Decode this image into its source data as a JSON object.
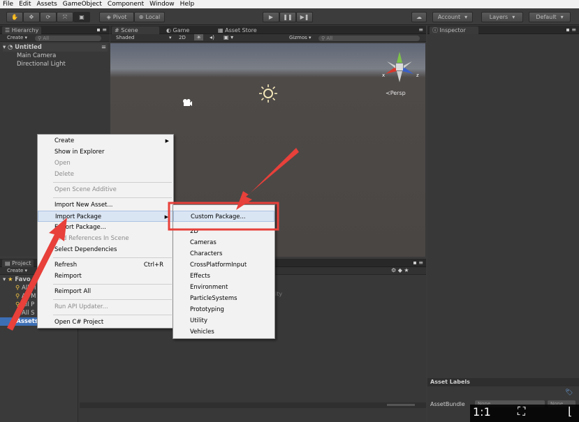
{
  "menubar": {
    "items": [
      "File",
      "Edit",
      "Assets",
      "GameObject",
      "Component",
      "Window",
      "Help"
    ]
  },
  "toolbar": {
    "pivot": "Pivot",
    "local": "Local",
    "account": "Account",
    "layers": "Layers",
    "layout": "Default"
  },
  "hierarchy": {
    "tab": "Hierarchy",
    "create": "Create",
    "search": "All",
    "scene": "Untitled",
    "items": [
      "Main Camera",
      "Directional Light"
    ]
  },
  "scene": {
    "tabs": [
      "Scene",
      "Game",
      "Asset Store"
    ],
    "shading": "Shaded",
    "mode2d": "2D",
    "gizmos": "Gizmos",
    "search": "All",
    "persp": "Persp",
    "axis_x": "x",
    "axis_z": "z"
  },
  "inspector": {
    "tab": "Inspector",
    "asset_labels": "Asset Labels",
    "asset_bundle": "AssetBundle",
    "bundle_value": "None",
    "bundle_value2": "None"
  },
  "project": {
    "tab": "Project",
    "create": "Create",
    "favorites": "Favo",
    "fav_items": [
      "All M",
      "All M",
      "All P",
      "All S"
    ],
    "assets": "Assets",
    "empty_hint": "ity"
  },
  "context_menu": {
    "create": "Create",
    "show_in_explorer": "Show in Explorer",
    "open": "Open",
    "delete": "Delete",
    "open_scene_additive": "Open Scene Additive",
    "import_new_asset": "Import New Asset...",
    "import_package": "Import Package",
    "export_package": "Export Package...",
    "find_references": "Find References In Scene",
    "select_dependencies": "Select Dependencies",
    "refresh": "Refresh",
    "refresh_shortcut": "Ctrl+R",
    "reimport": "Reimport",
    "reimport_all": "Reimport All",
    "run_api_updater": "Run API Updater...",
    "open_csharp_project": "Open C# Project"
  },
  "submenu": {
    "items": [
      "Custom Package...",
      "2D",
      "Cameras",
      "Characters",
      "CrossPlatformInput",
      "Effects",
      "Environment",
      "ParticleSystems",
      "Prototyping",
      "Utility",
      "Vehicles"
    ]
  },
  "zoom": {
    "ratio": "1:1"
  },
  "colors": {
    "annotation_red": "#e8403a",
    "highlight": "#dae5f3",
    "gizmo_x": "#d9372c",
    "gizmo_y": "#7ec34a",
    "gizmo_z": "#3a5fc8"
  }
}
